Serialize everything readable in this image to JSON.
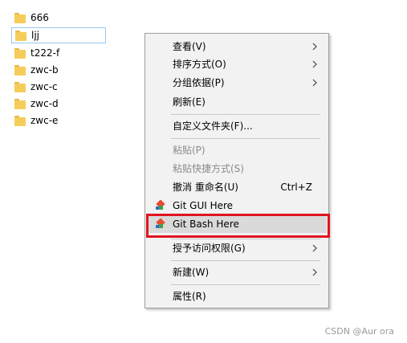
{
  "files": [
    {
      "name": "666",
      "selected": false
    },
    {
      "name": "ljj",
      "selected": true
    },
    {
      "name": "t222-f",
      "selected": false
    },
    {
      "name": "zwc-b",
      "selected": false
    },
    {
      "name": "zwc-c",
      "selected": false
    },
    {
      "name": "zwc-d",
      "selected": false
    },
    {
      "name": "zwc-e",
      "selected": false
    }
  ],
  "menu": {
    "view": "查看(V)",
    "sort": "排序方式(O)",
    "group": "分组依据(P)",
    "refresh": "刷新(E)",
    "customize": "自定义文件夹(F)...",
    "paste": "粘贴(P)",
    "paste_shortcut": "粘贴快捷方式(S)",
    "undo_rename": "撤消 重命名(U)",
    "undo_shortcut": "Ctrl+Z",
    "git_gui": "Git GUI Here",
    "git_bash": "Git Bash Here",
    "grant_access": "授予访问权限(G)",
    "new": "新建(W)",
    "properties": "属性(R)"
  },
  "highlight_color": "#e0141e",
  "watermark": "CSDN @Aur ora"
}
